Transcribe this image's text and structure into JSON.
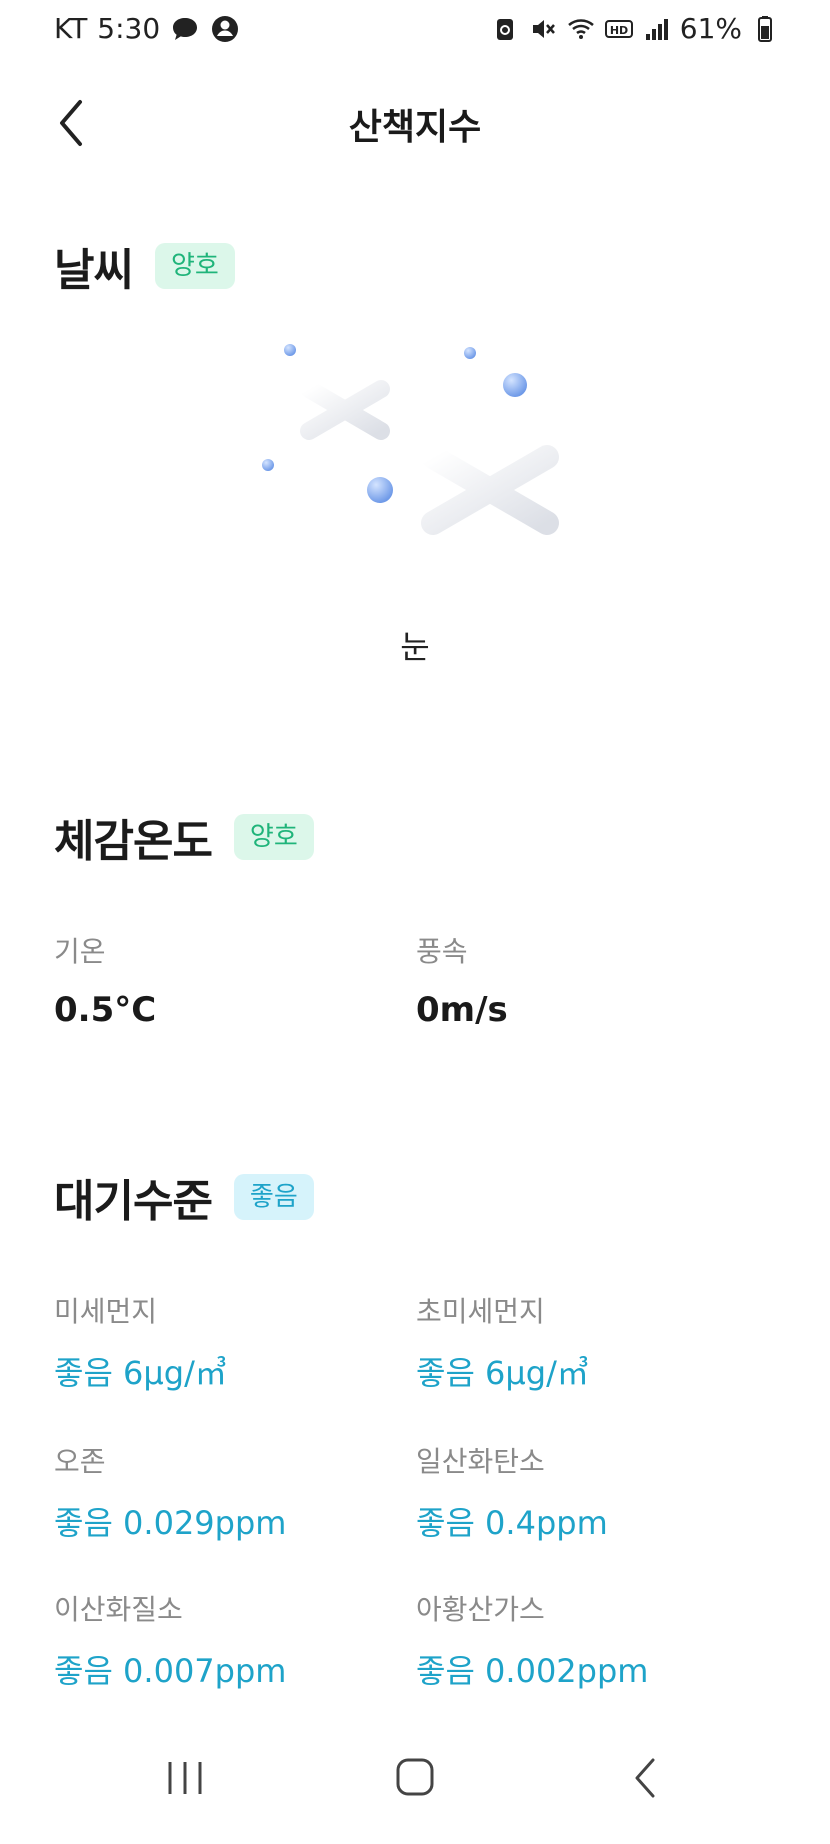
{
  "status_bar": {
    "carrier": "KT",
    "time": "5:30",
    "battery": "61%"
  },
  "header": {
    "title": "산책지수"
  },
  "weather": {
    "title": "날씨",
    "badge": "양호",
    "condition": "눈",
    "illustration_icon": "snowflake-icon"
  },
  "feels_like": {
    "title": "체감온도",
    "badge": "양호",
    "temp_label": "기온",
    "temp_value": "0.5°C",
    "wind_label": "풍속",
    "wind_value": "0m/s"
  },
  "air_quality": {
    "title": "대기수준",
    "badge": "좋음",
    "items": [
      {
        "label": "미세먼지",
        "value": "좋음 6μg/㎥"
      },
      {
        "label": "초미세먼지",
        "value": "좋음 6μg/㎥"
      },
      {
        "label": "오존",
        "value": "좋음 0.029ppm"
      },
      {
        "label": "일산화탄소",
        "value": "좋음 0.4ppm"
      },
      {
        "label": "이산화질소",
        "value": "좋음 0.007ppm"
      },
      {
        "label": "아황산가스",
        "value": "좋음 0.002ppm"
      }
    ]
  },
  "colors": {
    "good_green": "#1fb47a",
    "good_green_bg": "#dcf7ea",
    "good_blue": "#1ea3c9",
    "good_blue_bg": "#d6f3fb"
  }
}
